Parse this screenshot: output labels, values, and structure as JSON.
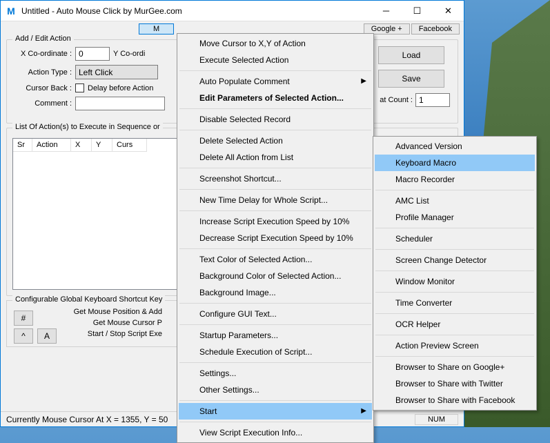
{
  "window": {
    "title": "Untitled - Auto Mouse Click by MurGee.com",
    "icon_letter": "M"
  },
  "topbar": {
    "btn_partial": "M",
    "google": "Google +",
    "facebook": "Facebook"
  },
  "addedit": {
    "group_title": "Add / Edit Action",
    "x_label": "X Co-ordinate :",
    "x_value": "0",
    "y_label": "Y Co-ordi",
    "action_type_label": "Action Type :",
    "action_type_value": "Left Click",
    "cursor_back_label": "Cursor Back :",
    "delay_label": "Delay before Action",
    "comment_label": "Comment :",
    "comment_value": ""
  },
  "right": {
    "load": "Load",
    "save": "Save",
    "repeat_trunc": "at Count :",
    "repeat_value": "1"
  },
  "list": {
    "group_title": "List Of Action(s) to Execute in Sequence or",
    "cols": {
      "sr": "Sr",
      "action": "Action",
      "x": "X",
      "y": "Y",
      "curs": "Curs"
    }
  },
  "cfg": {
    "group_title": "Configurable Global Keyboard Shortcut Key",
    "r1": "Get Mouse Position & Add",
    "r2": "Get Mouse Cursor P",
    "r3": "Start / Stop Script Exe",
    "hash": "#",
    "caret": "^",
    "a": "A"
  },
  "status": {
    "cursor": "Currently Mouse Cursor At X = 1355, Y = 50",
    "num": "NUM"
  },
  "menu1": [
    {
      "t": "Move Cursor to X,Y of Action"
    },
    {
      "t": "Execute Selected Action"
    },
    {
      "sep": true
    },
    {
      "t": "Auto Populate Comment",
      "sub": true
    },
    {
      "t": "Edit Parameters of Selected Action...",
      "bold": true
    },
    {
      "sep": true
    },
    {
      "t": "Disable Selected Record"
    },
    {
      "sep": true
    },
    {
      "t": "Delete Selected Action"
    },
    {
      "t": "Delete All Action from List"
    },
    {
      "sep": true
    },
    {
      "t": "Screenshot Shortcut..."
    },
    {
      "sep": true
    },
    {
      "t": "New Time Delay for Whole Script..."
    },
    {
      "sep": true
    },
    {
      "t": "Increase Script Execution Speed by 10%"
    },
    {
      "t": "Decrease Script Execution Speed by 10%"
    },
    {
      "sep": true
    },
    {
      "t": "Text Color of Selected Action..."
    },
    {
      "t": "Background Color of Selected Action..."
    },
    {
      "t": "Background Image..."
    },
    {
      "sep": true
    },
    {
      "t": "Configure GUI Text..."
    },
    {
      "sep": true
    },
    {
      "t": "Startup Parameters..."
    },
    {
      "t": "Schedule Execution of Script..."
    },
    {
      "sep": true
    },
    {
      "t": "Settings..."
    },
    {
      "t": "Other Settings..."
    },
    {
      "sep": true
    },
    {
      "t": "Start",
      "sub": true,
      "hi": true
    },
    {
      "sep": true
    },
    {
      "t": "View Script Execution Info..."
    }
  ],
  "menu2": [
    {
      "t": "Advanced Version"
    },
    {
      "t": "Keyboard Macro",
      "hi": true
    },
    {
      "t": "Macro Recorder"
    },
    {
      "sep": true
    },
    {
      "t": "AMC List"
    },
    {
      "t": "Profile Manager"
    },
    {
      "sep": true
    },
    {
      "t": "Scheduler"
    },
    {
      "sep": true
    },
    {
      "t": "Screen Change Detector"
    },
    {
      "sep": true
    },
    {
      "t": "Window Monitor"
    },
    {
      "sep": true
    },
    {
      "t": "Time Converter"
    },
    {
      "sep": true
    },
    {
      "t": "OCR Helper"
    },
    {
      "sep": true
    },
    {
      "t": "Action Preview Screen"
    },
    {
      "sep": true
    },
    {
      "t": "Browser to Share on Google+"
    },
    {
      "t": "Browser to Share with Twitter"
    },
    {
      "t": "Browser to Share with Facebook"
    }
  ]
}
